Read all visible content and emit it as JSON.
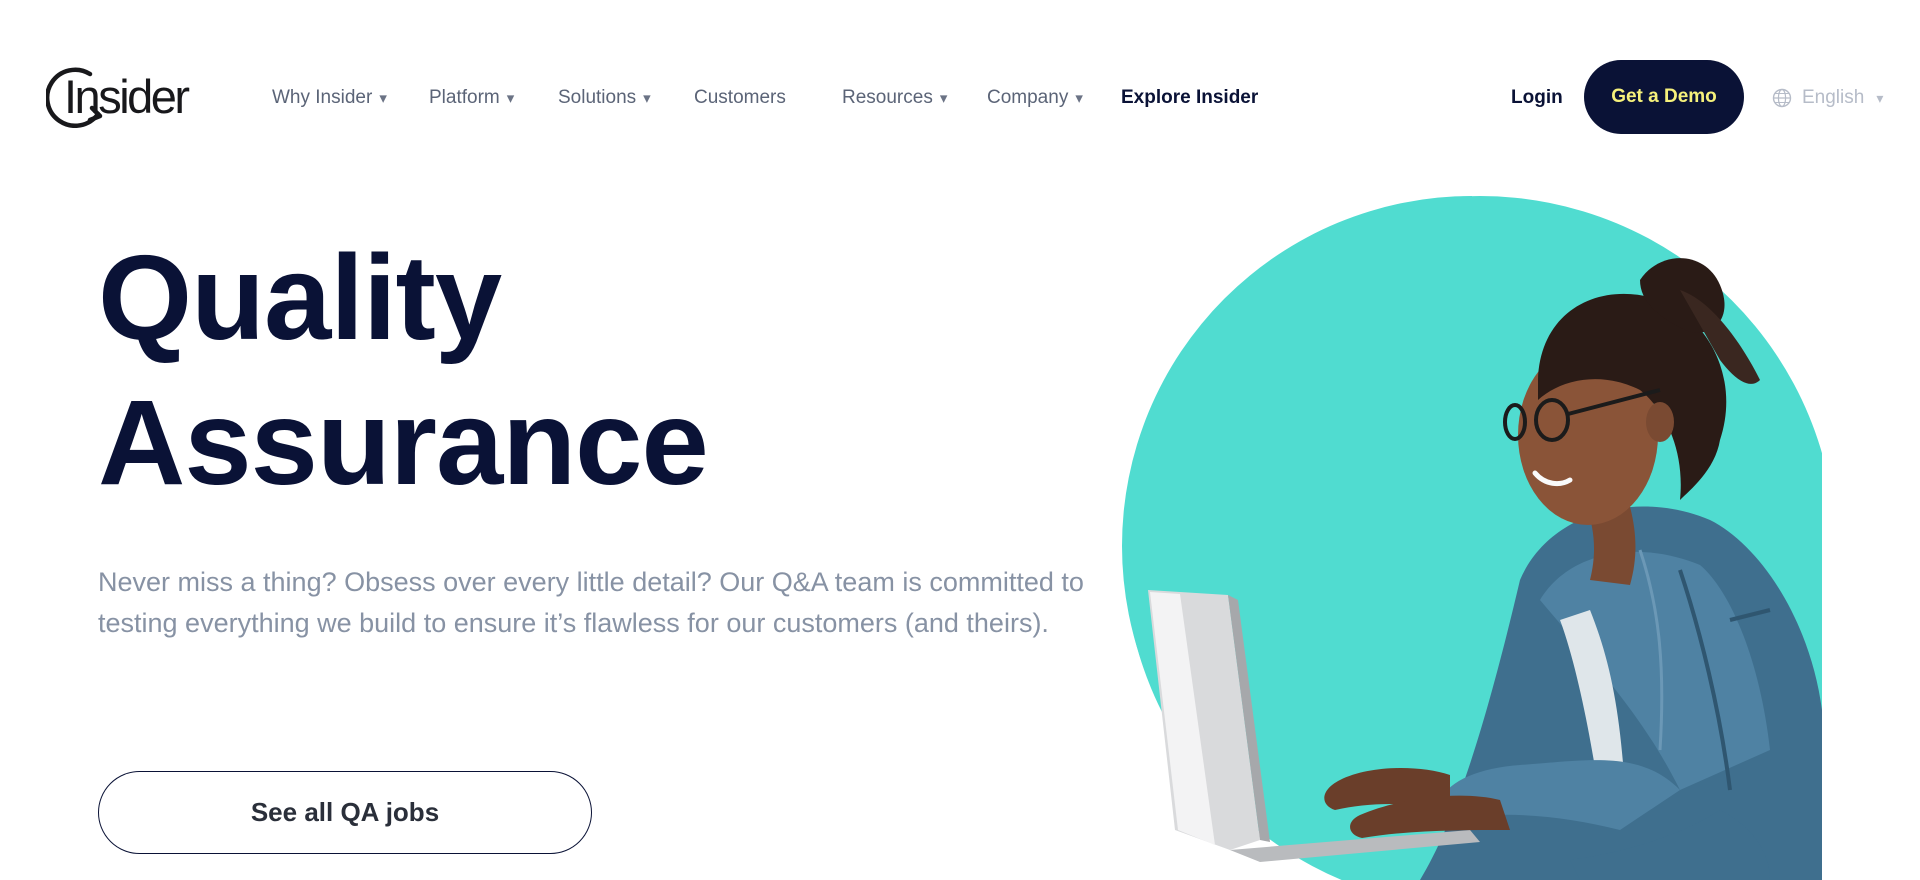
{
  "header": {
    "logo_text": "Insider",
    "nav": [
      {
        "label": "Why Insider",
        "has_dropdown": true
      },
      {
        "label": "Platform",
        "has_dropdown": true
      },
      {
        "label": "Solutions",
        "has_dropdown": true
      },
      {
        "label": "Customers",
        "has_dropdown": false
      },
      {
        "label": "Resources",
        "has_dropdown": true
      },
      {
        "label": "Company",
        "has_dropdown": true
      },
      {
        "label": "Explore Insider",
        "has_dropdown": false
      }
    ],
    "caret_glyph": "▾",
    "login_label": "Login",
    "demo_label": "Get a Demo",
    "language_label": "English",
    "language_icon": "globe-icon"
  },
  "hero": {
    "title_line1": "Quality",
    "title_line2": "Assurance",
    "subtitle": "Never miss a thing? Obsess over every little detail? Our Q&A team is committed to testing everything we build to ensure it’s flawless for our customers (and theirs).",
    "cta_label": "See all QA jobs"
  },
  "colors": {
    "navy": "#0a1236",
    "demo_text": "#f6f17b",
    "teal": "#50dcd0",
    "muted_text": "#8792a4",
    "nav_text": "#5b6477"
  }
}
